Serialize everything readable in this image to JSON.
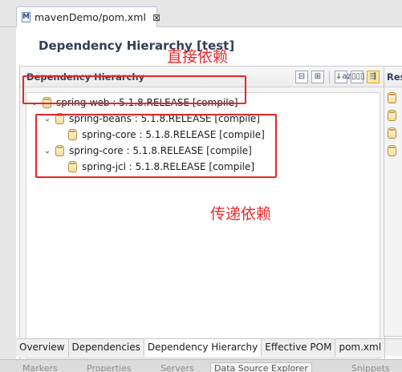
{
  "editor_tab": {
    "title": "mavenDemo/pom.xml",
    "close": "⊠",
    "icon": "M"
  },
  "page": {
    "title": "Dependency Hierarchy [test]"
  },
  "section": {
    "title": "Dependency Hierarchy",
    "tools": [
      "⊟",
      "⊞",
      "↓az",
      "▯▯▯",
      "⇶"
    ]
  },
  "tree": [
    {
      "label": "spring-web : 5.1.8.RELEASE [compile]",
      "expanded": true
    },
    {
      "label": "spring-beans : 5.1.8.RELEASE [compile]",
      "expanded": true
    },
    {
      "label": "spring-core : 5.1.8.RELEASE [compile]"
    },
    {
      "label": "spring-core : 5.1.8.RELEASE [compile]",
      "expanded": true
    },
    {
      "label": "spring-jcl : 5.1.8.RELEASE [compile]"
    }
  ],
  "annotations": {
    "direct": "直接依赖",
    "transitive": "传递依赖",
    "color": "#e8252a"
  },
  "right_section": {
    "title": "Res"
  },
  "page_tabs": [
    "Overview",
    "Dependencies",
    "Dependency Hierarchy",
    "Effective POM",
    "pom.xml"
  ],
  "active_page_tab": "Dependency Hierarchy",
  "bottom_views": [
    "Markers",
    "Properties",
    "Servers",
    "Data Source Explorer",
    "Snippets"
  ]
}
